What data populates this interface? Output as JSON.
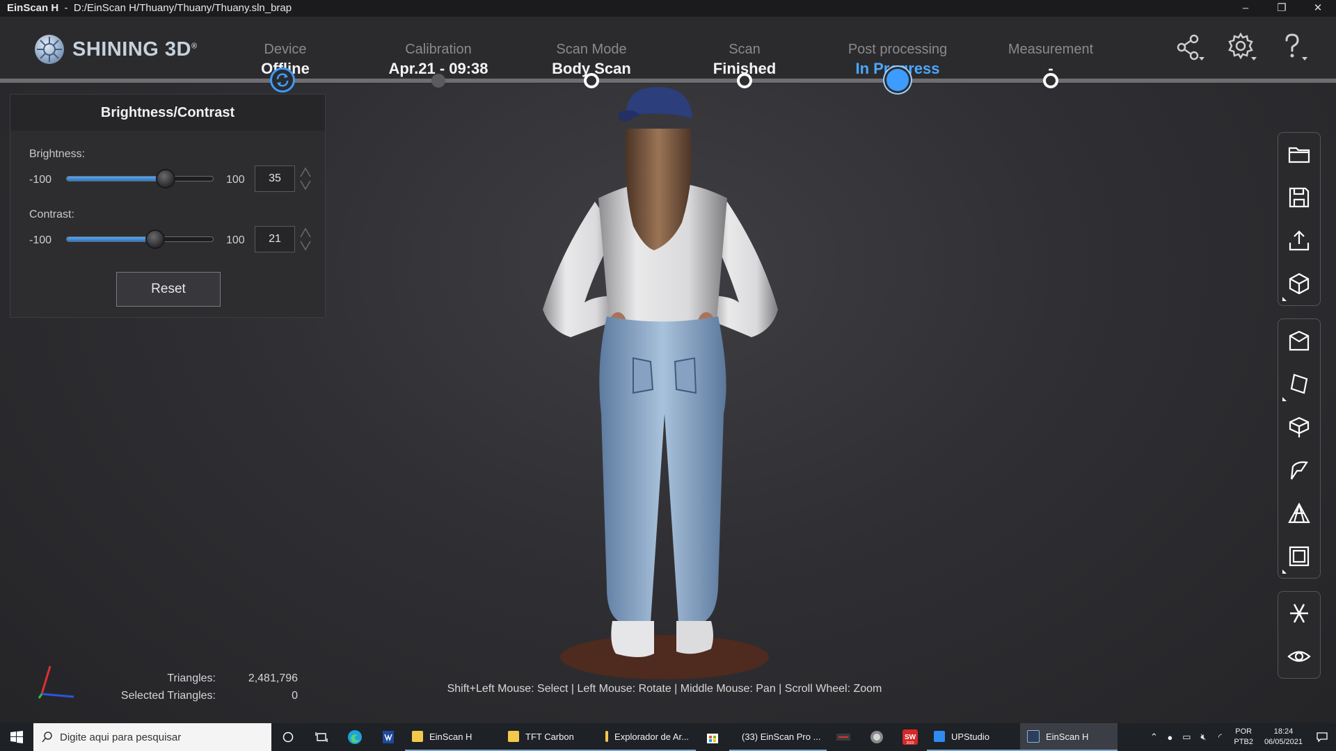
{
  "window": {
    "app_name": "EinScan H",
    "separator": "-",
    "file_path": "D:/EinScan H/Thuany/Thuany/Thuany.sln_brap",
    "minimize": "–",
    "restore": "❐",
    "close": "✕"
  },
  "brand": {
    "name": "SHINING 3D",
    "mark": "®"
  },
  "steps": [
    {
      "caption": "Device",
      "value": "Offline",
      "state": "done"
    },
    {
      "caption": "Calibration",
      "value": "Apr.21 - 09:38",
      "state": "done"
    },
    {
      "caption": "Scan Mode",
      "value": "Body Scan",
      "state": "done"
    },
    {
      "caption": "Scan",
      "value": "Finished",
      "state": "done"
    },
    {
      "caption": "Post processing",
      "value": "In Progress",
      "state": "active"
    },
    {
      "caption": "Measurement",
      "value": "-",
      "state": "pending"
    }
  ],
  "panel": {
    "title": "Brightness/Contrast",
    "brightness": {
      "label": "Brightness:",
      "min": "-100",
      "max": "100",
      "value": "35",
      "level": 35
    },
    "contrast": {
      "label": "Contrast:",
      "min": "-100",
      "max": "100",
      "value": "21",
      "level": 21
    },
    "reset_label": "Reset"
  },
  "toolbar": {
    "group1": [
      "open-folder-icon",
      "save-icon",
      "export-icon",
      "model-cube-icon"
    ],
    "group2": [
      "mesh-box-icon",
      "edit-plane-icon",
      "cut-cube-icon",
      "curvature-icon",
      "simplify-triangle-icon",
      "texture-cube-icon"
    ],
    "group3": [
      "flip-normals-icon",
      "view-eye-icon"
    ]
  },
  "stats": {
    "triangles_label": "Triangles:",
    "triangles_value": "2,481,796",
    "selected_label": "Selected Triangles:",
    "selected_value": "0"
  },
  "hint": "Shift+Left Mouse: Select | Left Mouse: Rotate | Middle Mouse: Pan | Scroll Wheel: Zoom",
  "taskbar": {
    "search_placeholder": "Digite aqui para pesquisar",
    "apps": [
      {
        "label": "EinScan H",
        "color": "#f2c94c"
      },
      {
        "label": "TFT Carbon",
        "color": "#f2c94c"
      },
      {
        "label": "Explorador de Ar...",
        "color": "#f2c94c"
      },
      {
        "label": "(33) EinScan Pro ...",
        "color": "#e94335"
      },
      {
        "label": "UPStudio",
        "color": "#2d8cf0"
      },
      {
        "label": "EinScan H",
        "color": "#2c3e5a"
      }
    ],
    "lang": "POR",
    "layout": "PTB2",
    "time": "18:24",
    "date": "06/05/2021",
    "sw_year": "2020"
  }
}
